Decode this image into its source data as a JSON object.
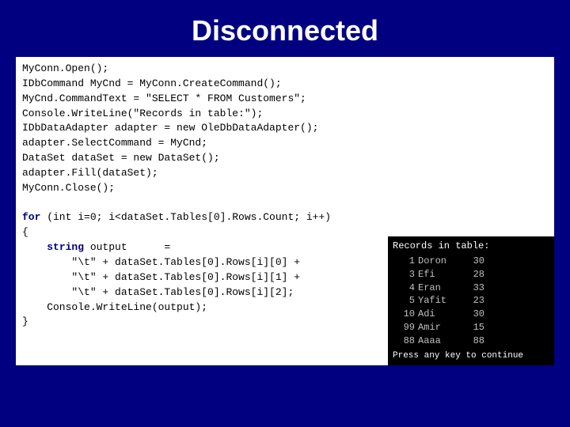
{
  "title": "Disconnected",
  "code": {
    "lines": [
      {
        "text": "MyConn.Open();",
        "type": "normal"
      },
      {
        "text": "IDbCommand MyCnd = MyConn.CreateCommand();",
        "type": "normal"
      },
      {
        "text": "MyCnd.CommandText = \"SELECT * FROM Customers\";",
        "type": "normal"
      },
      {
        "text": "Console.WriteLine(\"Records in table:\");",
        "type": "normal"
      },
      {
        "text": "IDbDataAdapter adapter = new OleDbDataAdapter();",
        "type": "normal"
      },
      {
        "text": "adapter.SelectCommand = MyCnd;",
        "type": "normal"
      },
      {
        "text": "DataSet dataSet = new DataSet();",
        "type": "normal"
      },
      {
        "text": "adapter.Fill(dataSet);",
        "type": "normal"
      },
      {
        "text": "MyConn.Close();",
        "type": "normal"
      },
      {
        "text": "",
        "type": "normal"
      },
      {
        "text": "for (int i=0; i<dataSet.Tables[0].Rows.Count; i++)",
        "type": "for"
      },
      {
        "text": "{",
        "type": "normal"
      },
      {
        "text": "    string output      =",
        "type": "string_kw"
      },
      {
        "text": "        \"\\t\" + dataSet.Tables[0].Rows[i][0] +",
        "type": "normal"
      },
      {
        "text": "        \"\\t\" + dataSet.Tables[0].Rows[i][1] +",
        "type": "normal"
      },
      {
        "text": "        \"\\t\" + dataSet.Tables[0].Rows[i][2];",
        "type": "normal"
      },
      {
        "text": "    Console.WriteLine(output);",
        "type": "normal"
      },
      {
        "text": "}",
        "type": "normal"
      }
    ]
  },
  "console": {
    "header": "Records in table:",
    "records": [
      {
        "id": "1",
        "name": "Doron",
        "val": "30"
      },
      {
        "id": "3",
        "name": "Efi",
        "val": "28"
      },
      {
        "id": "4",
        "name": "Eran",
        "val": "33"
      },
      {
        "id": "5",
        "name": "Yafit",
        "val": "23"
      },
      {
        "id": "10",
        "name": "Adi",
        "val": "30"
      },
      {
        "id": "99",
        "name": "Amir",
        "val": "15"
      },
      {
        "id": "88",
        "name": "Aaaa",
        "val": "88"
      }
    ],
    "footer": "Press any key to continue"
  }
}
